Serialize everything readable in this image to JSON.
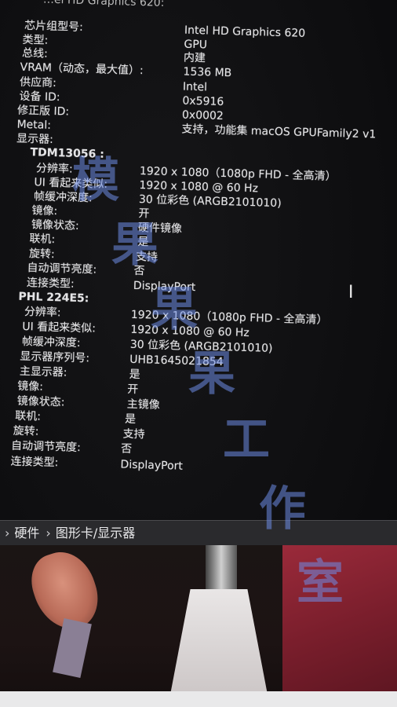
{
  "top_cut_text": "…el HD Graphics 620:",
  "gpu": [
    {
      "key": "芯片组型号:",
      "value": "Intel HD Graphics 620"
    },
    {
      "key": "类型:",
      "value": "GPU"
    },
    {
      "key": "总线:",
      "value": "内建"
    },
    {
      "key": "VRAM（动态，最大值）:",
      "value": "1536 MB"
    },
    {
      "key": "供应商:",
      "value": "Intel"
    },
    {
      "key": "设备 ID:",
      "value": "0x5916"
    },
    {
      "key": "修正版 ID:",
      "value": "0x0002"
    },
    {
      "key": "Metal:",
      "value": "支持，功能集 macOS GPUFamily2 v1"
    },
    {
      "key": "显示器:",
      "value": ""
    }
  ],
  "display1": {
    "name": "TDM13056    :",
    "rows": [
      {
        "key": "分辨率:",
        "value": "1920 x 1080（1080p FHD - 全高清）"
      },
      {
        "key": "UI 看起来类似:",
        "value": "1920 x 1080 @ 60 Hz"
      },
      {
        "key": "帧缓冲深度:",
        "value": "30 位彩色 (ARGB2101010)"
      },
      {
        "key": "镜像:",
        "value": "开"
      },
      {
        "key": "镜像状态:",
        "value": "硬件镜像"
      },
      {
        "key": "联机:",
        "value": "是"
      },
      {
        "key": "旋转:",
        "value": "支持"
      },
      {
        "key": "自动调节亮度:",
        "value": "否"
      },
      {
        "key": "连接类型:",
        "value": "DisplayPort"
      }
    ]
  },
  "display2": {
    "name": "PHL 224E5:",
    "rows": [
      {
        "key": "分辨率:",
        "value": "1920 x 1080（1080p FHD - 全高清）"
      },
      {
        "key": "UI 看起来类似:",
        "value": "1920 x 1080 @ 60 Hz"
      },
      {
        "key": "帧缓冲深度:",
        "value": "30 位彩色 (ARGB2101010)"
      },
      {
        "key": "显示器序列号:",
        "value": "UHB1645021854"
      },
      {
        "key": "主显示器:",
        "value": "是"
      },
      {
        "key": "镜像:",
        "value": "开"
      },
      {
        "key": "镜像状态:",
        "value": "主镜像"
      },
      {
        "key": "联机:",
        "value": "是"
      },
      {
        "key": "旋转:",
        "value": "支持"
      },
      {
        "key": "自动调节亮度:",
        "value": "否"
      },
      {
        "key": "连接类型:",
        "value": "DisplayPort"
      }
    ]
  },
  "breadcrumb": [
    "硬件",
    "图形卡/显示器"
  ],
  "watermark_chars": [
    "模",
    "果",
    "果",
    "果",
    "工",
    "作",
    "室"
  ],
  "colors": {
    "text": "#e4e4e6",
    "background": "#0d0d0f",
    "watermark": "#6e8ce6"
  }
}
